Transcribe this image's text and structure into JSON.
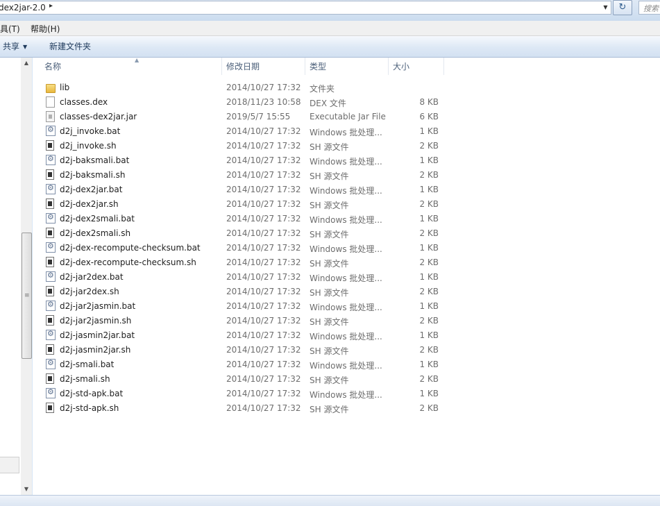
{
  "address": {
    "path": "dex2jar-2.0",
    "separator": "▸",
    "dropdown": "▼",
    "refresh": "↻",
    "search_placeholder": "搜索"
  },
  "menu": {
    "tools": "具(T)",
    "help": "帮助(H)"
  },
  "toolbar": {
    "share": "共享",
    "share_arrow": "▼",
    "new_folder": "新建文件夹"
  },
  "columns": {
    "name": "名称",
    "date": "修改日期",
    "type": "类型",
    "size": "大小",
    "sort_indicator": "▲"
  },
  "files": [
    {
      "name": "lib",
      "date": "2014/10/27 17:32",
      "type": "文件夹",
      "size": "",
      "icon": "folder-icon"
    },
    {
      "name": "classes.dex",
      "date": "2018/11/23 10:58",
      "type": "DEX 文件",
      "size": "8 KB",
      "icon": "file-icon"
    },
    {
      "name": "classes-dex2jar.jar",
      "date": "2019/5/7 15:55",
      "type": "Executable Jar File",
      "size": "6 KB",
      "icon": "jar-file-icon"
    },
    {
      "name": "d2j_invoke.bat",
      "date": "2014/10/27 17:32",
      "type": "Windows 批处理...",
      "size": "1 KB",
      "icon": "batch-file-icon"
    },
    {
      "name": "d2j_invoke.sh",
      "date": "2014/10/27 17:32",
      "type": "SH 源文件",
      "size": "2 KB",
      "icon": "shell-file-icon"
    },
    {
      "name": "d2j-baksmali.bat",
      "date": "2014/10/27 17:32",
      "type": "Windows 批处理...",
      "size": "1 KB",
      "icon": "batch-file-icon"
    },
    {
      "name": "d2j-baksmali.sh",
      "date": "2014/10/27 17:32",
      "type": "SH 源文件",
      "size": "2 KB",
      "icon": "shell-file-icon"
    },
    {
      "name": "d2j-dex2jar.bat",
      "date": "2014/10/27 17:32",
      "type": "Windows 批处理...",
      "size": "1 KB",
      "icon": "batch-file-icon"
    },
    {
      "name": "d2j-dex2jar.sh",
      "date": "2014/10/27 17:32",
      "type": "SH 源文件",
      "size": "2 KB",
      "icon": "shell-file-icon"
    },
    {
      "name": "d2j-dex2smali.bat",
      "date": "2014/10/27 17:32",
      "type": "Windows 批处理...",
      "size": "1 KB",
      "icon": "batch-file-icon"
    },
    {
      "name": "d2j-dex2smali.sh",
      "date": "2014/10/27 17:32",
      "type": "SH 源文件",
      "size": "2 KB",
      "icon": "shell-file-icon"
    },
    {
      "name": "d2j-dex-recompute-checksum.bat",
      "date": "2014/10/27 17:32",
      "type": "Windows 批处理...",
      "size": "1 KB",
      "icon": "batch-file-icon"
    },
    {
      "name": "d2j-dex-recompute-checksum.sh",
      "date": "2014/10/27 17:32",
      "type": "SH 源文件",
      "size": "2 KB",
      "icon": "shell-file-icon"
    },
    {
      "name": "d2j-jar2dex.bat",
      "date": "2014/10/27 17:32",
      "type": "Windows 批处理...",
      "size": "1 KB",
      "icon": "batch-file-icon"
    },
    {
      "name": "d2j-jar2dex.sh",
      "date": "2014/10/27 17:32",
      "type": "SH 源文件",
      "size": "2 KB",
      "icon": "shell-file-icon"
    },
    {
      "name": "d2j-jar2jasmin.bat",
      "date": "2014/10/27 17:32",
      "type": "Windows 批处理...",
      "size": "1 KB",
      "icon": "batch-file-icon"
    },
    {
      "name": "d2j-jar2jasmin.sh",
      "date": "2014/10/27 17:32",
      "type": "SH 源文件",
      "size": "2 KB",
      "icon": "shell-file-icon"
    },
    {
      "name": "d2j-jasmin2jar.bat",
      "date": "2014/10/27 17:32",
      "type": "Windows 批处理...",
      "size": "1 KB",
      "icon": "batch-file-icon"
    },
    {
      "name": "d2j-jasmin2jar.sh",
      "date": "2014/10/27 17:32",
      "type": "SH 源文件",
      "size": "2 KB",
      "icon": "shell-file-icon"
    },
    {
      "name": "d2j-smali.bat",
      "date": "2014/10/27 17:32",
      "type": "Windows 批处理...",
      "size": "1 KB",
      "icon": "batch-file-icon"
    },
    {
      "name": "d2j-smali.sh",
      "date": "2014/10/27 17:32",
      "type": "SH 源文件",
      "size": "2 KB",
      "icon": "shell-file-icon"
    },
    {
      "name": "d2j-std-apk.bat",
      "date": "2014/10/27 17:32",
      "type": "Windows 批处理...",
      "size": "1 KB",
      "icon": "batch-file-icon"
    },
    {
      "name": "d2j-std-apk.sh",
      "date": "2014/10/27 17:32",
      "type": "SH 源文件",
      "size": "2 KB",
      "icon": "shell-file-icon"
    }
  ],
  "scrollbar": {
    "up": "▲",
    "down": "▼",
    "grip": "≡"
  }
}
